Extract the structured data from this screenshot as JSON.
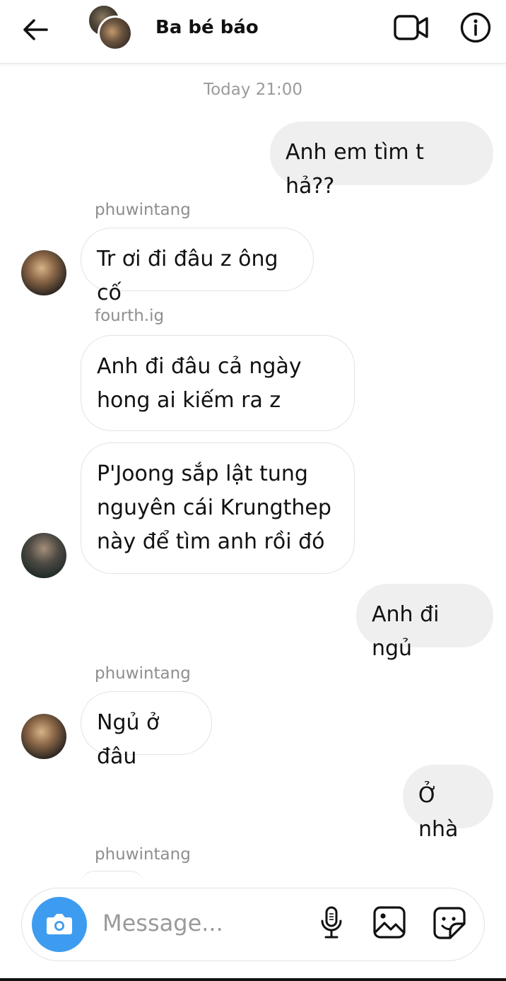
{
  "header": {
    "title": "Ba bé báo",
    "icons": [
      "back-arrow-icon",
      "video-call-icon",
      "info-icon"
    ]
  },
  "timestamp": "Today 21:00",
  "messages": [
    {
      "direction": "out",
      "text": "Anh em tìm t hả??"
    },
    {
      "direction": "in",
      "sender": "phuwintang",
      "text": "Tr ơi đi đâu z ông cố"
    },
    {
      "direction": "in",
      "sender": "fourth.ig",
      "lines": [
        "Anh đi đâu cả ngày",
        "hong ai kiếm ra z"
      ]
    },
    {
      "direction": "in",
      "lines": [
        "P'Joong sắp lật tung",
        "nguyên cái Krungthep",
        "này để tìm anh rồi đó"
      ]
    },
    {
      "direction": "out",
      "text": "Anh đi ngủ"
    },
    {
      "direction": "in",
      "sender": "phuwintang",
      "text": "Ngủ ở đâu"
    },
    {
      "direction": "out",
      "text": "Ở nhà"
    },
    {
      "direction": "in",
      "sender": "phuwintang"
    }
  ],
  "composer": {
    "placeholder": "Message...",
    "camera_color": "#3d9cf0",
    "icons": [
      "camera-icon",
      "microphone-icon",
      "gallery-icon",
      "sticker-icon"
    ]
  }
}
